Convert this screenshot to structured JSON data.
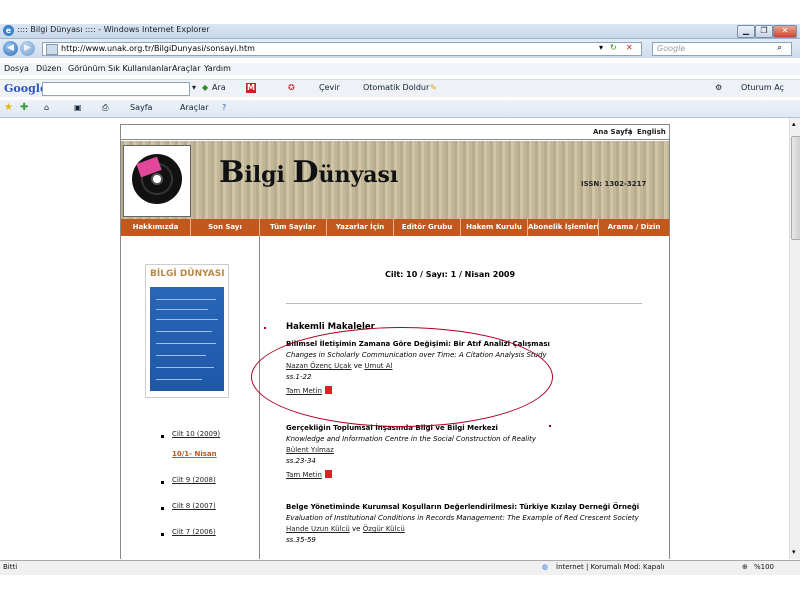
{
  "window": {
    "title": ":::: Bilgi Dünyası :::: - Windows Internet Explorer"
  },
  "address": {
    "url": "http://www.unak.org.tr/BilgiDunyasi/sonsayi.htm",
    "search_placeholder": "Google"
  },
  "menu": [
    "Dosya",
    "Düzen",
    "Görünüm",
    "Sık Kullanılanlar",
    "Araçlar",
    "Yardım"
  ],
  "google_toolbar": {
    "logo": "Google",
    "search": "Ara",
    "translate": "Çevir",
    "autofill": "Otomatik Doldur",
    "signin": "Oturum Aç"
  },
  "command_bar": {
    "page": "Sayfa",
    "tools": "Araçlar"
  },
  "top_links": {
    "home": "Ana Sayfa",
    "english": "English"
  },
  "header": {
    "brand_first": "B",
    "brand_rest1": "ilgi ",
    "brand_second": "D",
    "brand_rest2": "ünyası",
    "issn": "ISSN: 1302-3217"
  },
  "nav": [
    "Hakkımızda",
    "Son Sayı",
    "Tüm Sayılar",
    "Yazarlar İçin",
    "Editör Grubu",
    "Hakem Kurulu",
    "Abonelik İşlemleri",
    "Arama / Dizin"
  ],
  "cover": {
    "title": "BİLGİ DÜNYASI"
  },
  "volumes": {
    "v10": "Cilt 10 (2009)",
    "v10_issue": "10/1- Nisan",
    "v9": "Cilt 9 (2008)",
    "v8": "Cilt 8 (2007)",
    "v7": "Cilt 7 (2006)"
  },
  "issue": {
    "heading": "Cilt: 10 / Sayı: 1 / Nisan 2009",
    "section": "Hakemli Makaleler"
  },
  "articles": [
    {
      "title": "Bilimsel İletişimin Zamana Göre Değişimi: Bir Atıf Analizi Çalışması",
      "english": "Changes in Scholarly Communication over Time: A Citation Analysis Study",
      "author1": "Nazan Özenç Uçak",
      "and": "ve",
      "author2": "Umut Al",
      "pages": "ss.1-22",
      "fulltext": "Tam Metin"
    },
    {
      "title": "Gerçekliğin Toplumsal İnşasında Bilgi ve Bilgi Merkezi",
      "english": "Knowledge and Information Centre in the Social Construction of Reality",
      "author1": "Bülent Yılmaz",
      "pages": "ss.23-34",
      "fulltext": "Tam Metin"
    },
    {
      "title": "Belge Yönetiminde Kurumsal Koşulların Değerlendirilmesi: Türkiye Kızılay Derneği Örneği",
      "english": "Evaluation of Institutional Conditions in Records Management: The Example of Red Crescent Society",
      "author1": "Hande Uzun Külcü",
      "and": "ve",
      "author2": "Özgür Külcü",
      "pages": "ss.35-59"
    }
  ],
  "status": {
    "left": "Bitti",
    "zone": "İnternet | Korumalı Mod: Kapalı",
    "zoom": "%100"
  },
  "colors": {
    "nav_bg": "#c2581d",
    "annotation": "#b00020"
  }
}
